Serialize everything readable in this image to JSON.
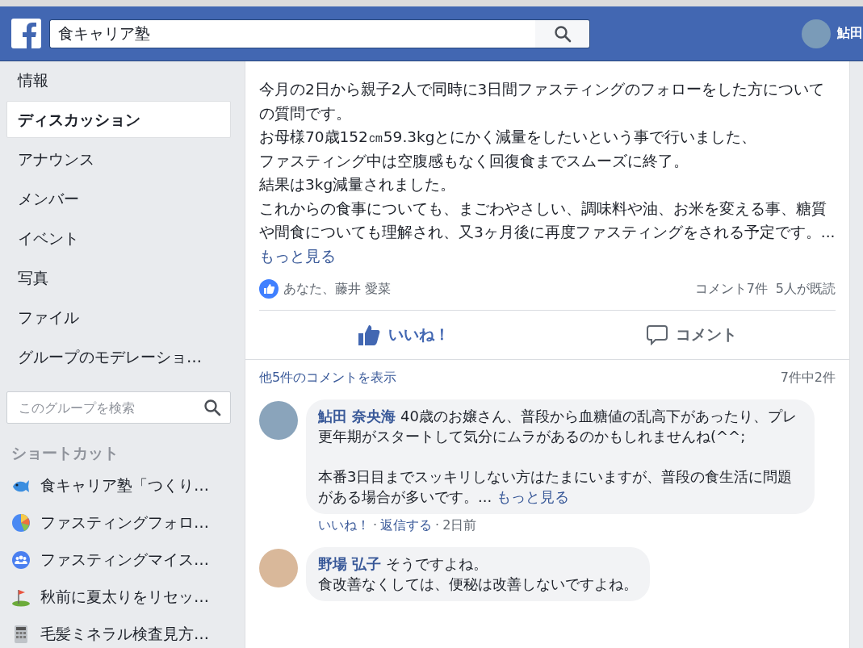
{
  "header": {
    "search_value": "食キャリア塾",
    "user_name": "鮎田"
  },
  "sidebar": {
    "items": [
      {
        "label": "情報",
        "selected": false
      },
      {
        "label": "ディスカッション",
        "selected": true
      },
      {
        "label": "アナウンス",
        "selected": false
      },
      {
        "label": "メンバー",
        "selected": false
      },
      {
        "label": "イベント",
        "selected": false
      },
      {
        "label": "写真",
        "selected": false
      },
      {
        "label": "ファイル",
        "selected": false
      },
      {
        "label": "グループのモデレーショ…",
        "selected": false
      }
    ],
    "group_search": {
      "placeholder": "このグループを検索"
    },
    "shortcuts_title": "ショートカット",
    "shortcuts": [
      {
        "kind": "fish",
        "label": "食キャリア塾「つくり…"
      },
      {
        "kind": "pie",
        "label": "ファスティングフォロ…"
      },
      {
        "kind": "group",
        "label": "ファスティングマイス…"
      },
      {
        "kind": "flag",
        "label": "秋前に夏太りをリセッ…"
      },
      {
        "kind": "calculator",
        "label": "毛髪ミネラル検査見方…"
      }
    ]
  },
  "post": {
    "body_lines": [
      "今月の2日から親子2人で同時に3日間ファスティングのフォローをした方についての質問です。",
      "お母様70歳152㎝59.3kgとにかく減量をしたいという事で行いました、",
      "ファスティング中は空腹感もなく回復食までスムーズに終了。",
      "結果は3kg減量されました。",
      "これからの食事についても、まごわやさしい、調味料や油、お米を変える事、糖質や間食についても理解され、又3ヶ月後に再度ファスティングをされる予定です。..."
    ],
    "see_more": "もっと見る",
    "likers": "あなた、藤井 愛菜",
    "comment_count": "コメント7件",
    "seen_count": "5人が既読",
    "like_button": {
      "label": "いいね！",
      "liked": true
    },
    "comment_button": "コメント",
    "show_more_comments": "他5件のコメントを表示",
    "comment_range": "7件中2件",
    "comments": [
      {
        "author": "鮎田 奈央海",
        "kind": "paragraphs",
        "blocks": [
          "40歳のお嬢さん、普段から血糖値の乱高下があったり、プレ更年期がスタートして気分にムラがあるのかもしれませんね(^^;",
          "本番3日目までスッキリしない方はたまにいますが、普段の食生活に問題がある場合が多いです。..."
        ],
        "see_more": "もっと見る",
        "actions": [
          {
            "kind": "link",
            "label": "いいね！"
          },
          {
            "kind": "separator",
            "label": "·"
          },
          {
            "kind": "link",
            "label": "返信する"
          },
          {
            "kind": "separator",
            "label": "·"
          },
          {
            "kind": "time",
            "label": "2日前"
          }
        ]
      },
      {
        "author": "野場 弘子",
        "kind": "lines",
        "blocks": [
          "そうですよね。",
          "食改善なくしては、便秘は改善しないですよね。"
        ]
      }
    ]
  }
}
